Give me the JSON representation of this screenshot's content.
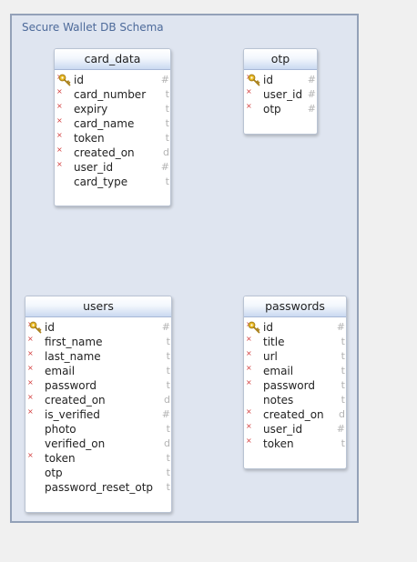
{
  "schema": {
    "title": "Secure Wallet DB Schema"
  },
  "tables": {
    "card_data": {
      "name": "card_data",
      "columns": [
        {
          "name": "id",
          "type": "#",
          "pk": true,
          "required": true
        },
        {
          "name": "card_number",
          "type": "t",
          "pk": false,
          "required": true
        },
        {
          "name": "expiry",
          "type": "t",
          "pk": false,
          "required": true
        },
        {
          "name": "card_name",
          "type": "t",
          "pk": false,
          "required": true
        },
        {
          "name": "token",
          "type": "t",
          "pk": false,
          "required": true
        },
        {
          "name": "created_on",
          "type": "d",
          "pk": false,
          "required": true
        },
        {
          "name": "user_id",
          "type": "#",
          "pk": false,
          "required": true
        },
        {
          "name": "card_type",
          "type": "t",
          "pk": false,
          "required": false
        }
      ]
    },
    "otp": {
      "name": "otp",
      "columns": [
        {
          "name": "id",
          "type": "#",
          "pk": true,
          "required": true
        },
        {
          "name": "user_id",
          "type": "#",
          "pk": false,
          "required": true
        },
        {
          "name": "otp",
          "type": "#",
          "pk": false,
          "required": true
        }
      ]
    },
    "users": {
      "name": "users",
      "columns": [
        {
          "name": "id",
          "type": "#",
          "pk": true,
          "required": true
        },
        {
          "name": "first_name",
          "type": "t",
          "pk": false,
          "required": true
        },
        {
          "name": "last_name",
          "type": "t",
          "pk": false,
          "required": true
        },
        {
          "name": "email",
          "type": "t",
          "pk": false,
          "required": true
        },
        {
          "name": "password",
          "type": "t",
          "pk": false,
          "required": true
        },
        {
          "name": "created_on",
          "type": "d",
          "pk": false,
          "required": true
        },
        {
          "name": "is_verified",
          "type": "#",
          "pk": false,
          "required": true
        },
        {
          "name": "photo",
          "type": "t",
          "pk": false,
          "required": false
        },
        {
          "name": "verified_on",
          "type": "d",
          "pk": false,
          "required": false
        },
        {
          "name": "token",
          "type": "t",
          "pk": false,
          "required": true
        },
        {
          "name": "otp",
          "type": "t",
          "pk": false,
          "required": false
        },
        {
          "name": "password_reset_otp",
          "type": "t",
          "pk": false,
          "required": false
        }
      ]
    },
    "passwords": {
      "name": "passwords",
      "columns": [
        {
          "name": "id",
          "type": "#",
          "pk": true,
          "required": true
        },
        {
          "name": "title",
          "type": "t",
          "pk": false,
          "required": true
        },
        {
          "name": "url",
          "type": "t",
          "pk": false,
          "required": true
        },
        {
          "name": "email",
          "type": "t",
          "pk": false,
          "required": true
        },
        {
          "name": "password",
          "type": "t",
          "pk": false,
          "required": true
        },
        {
          "name": "notes",
          "type": "t",
          "pk": false,
          "required": false
        },
        {
          "name": "created_on",
          "type": "d",
          "pk": false,
          "required": true
        },
        {
          "name": "user_id",
          "type": "#",
          "pk": false,
          "required": true
        },
        {
          "name": "token",
          "type": "t",
          "pk": false,
          "required": true
        }
      ]
    }
  },
  "colors": {
    "canvas": "#dfe5f0",
    "border": "#93a1b8",
    "title": "#4d6a9a",
    "required_marker": "#d23a3a",
    "key": "#d9a520"
  },
  "icons": {
    "primary_key": "key-icon",
    "required": "required-marker-icon"
  }
}
